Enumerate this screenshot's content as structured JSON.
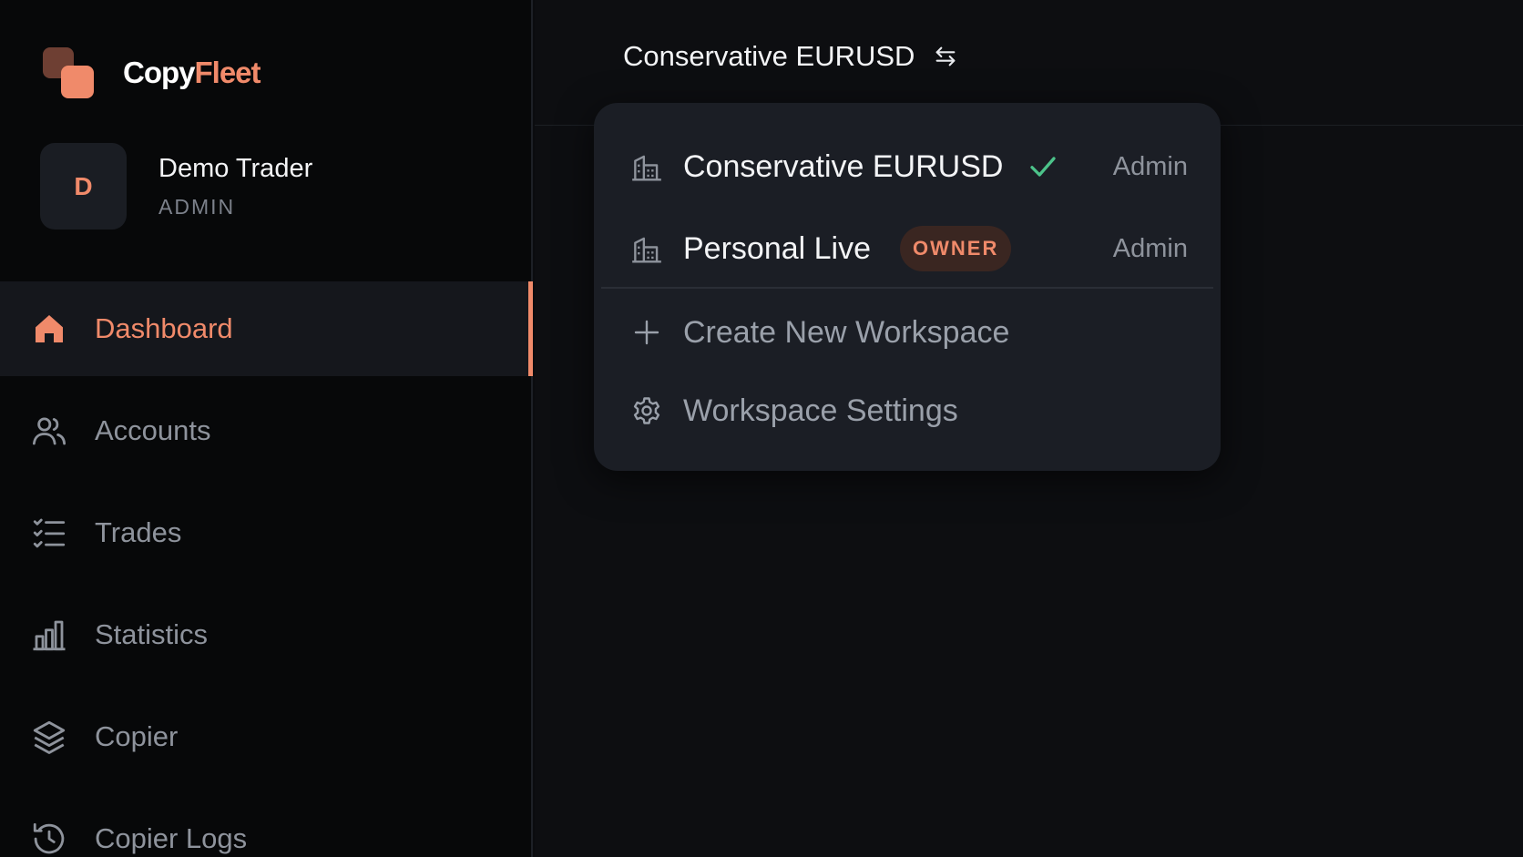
{
  "brand": {
    "name_part1": "Copy",
    "name_part2": "Fleet"
  },
  "user": {
    "initial": "D",
    "name": "Demo Trader",
    "role": "ADMIN"
  },
  "nav": {
    "items": [
      {
        "label": "Dashboard",
        "icon": "home-icon",
        "active": true
      },
      {
        "label": "Accounts",
        "icon": "users-icon",
        "active": false
      },
      {
        "label": "Trades",
        "icon": "checklist-icon",
        "active": false
      },
      {
        "label": "Statistics",
        "icon": "bar-chart-icon",
        "active": false
      },
      {
        "label": "Copier",
        "icon": "layers-icon",
        "active": false
      },
      {
        "label": "Copier Logs",
        "icon": "history-icon",
        "active": false
      }
    ]
  },
  "header": {
    "current_workspace": "Conservative EURUSD",
    "switch_icon": "swap-arrows-icon"
  },
  "workspace_menu": {
    "workspaces": [
      {
        "name": "Conservative EURUSD",
        "selected": true,
        "badge": "",
        "role": "Admin"
      },
      {
        "name": "Personal Live",
        "selected": false,
        "badge": "OWNER",
        "role": "Admin"
      }
    ],
    "create_label": "Create New Workspace",
    "settings_label": "Workspace Settings"
  },
  "colors": {
    "accent": "#f08a6a",
    "check": "#4cc38a",
    "background": "#0b0c0f",
    "sidebar": "#070809",
    "menu": "#1b1e25"
  }
}
